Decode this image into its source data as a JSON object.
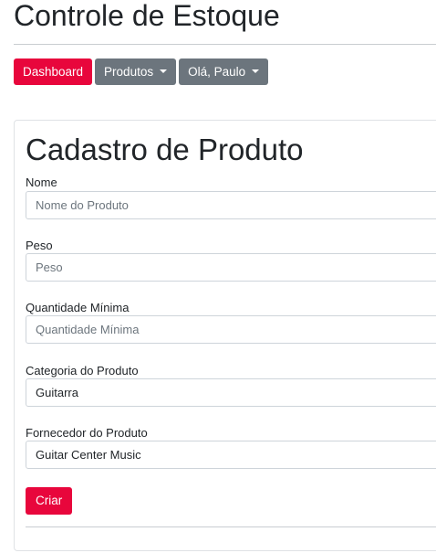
{
  "header": {
    "title": "Controle de Estoque"
  },
  "nav": {
    "dashboard_label": "Dashboard",
    "produtos_label": "Produtos",
    "user_label": "Olá, Paulo"
  },
  "form": {
    "title": "Cadastro de Produto",
    "fields": {
      "nome": {
        "label": "Nome",
        "placeholder": "Nome do Produto",
        "value": ""
      },
      "peso": {
        "label": "Peso",
        "placeholder": "Peso",
        "value": ""
      },
      "quantidade_minima": {
        "label": "Quantidade Mínima",
        "placeholder": "Quantidade Mínima",
        "value": ""
      },
      "categoria": {
        "label": "Categoria do Produto",
        "selected": "Guitarra"
      },
      "fornecedor": {
        "label": "Fornecedor do Produto",
        "selected": "Guitar Center Music"
      }
    },
    "submit_label": "Criar"
  },
  "colors": {
    "primary": "#e8063c",
    "secondary": "#6c757d",
    "border": "#ced4da",
    "text": "#212529"
  }
}
